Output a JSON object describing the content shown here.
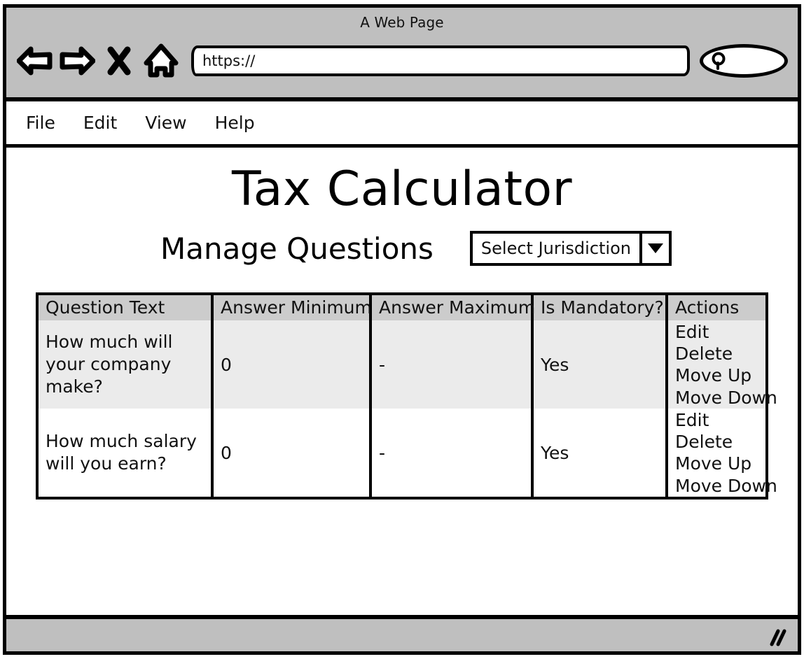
{
  "browser": {
    "window_title": "A Web Page",
    "nav": [
      {
        "name": "back-icon",
        "label": "Back"
      },
      {
        "name": "forward-icon",
        "label": "Forward"
      },
      {
        "name": "stop-icon",
        "label": "Stop"
      },
      {
        "name": "home-icon",
        "label": "Home"
      }
    ],
    "url_value": "https://",
    "url_placeholder": "https://",
    "search_icon": "search-icon",
    "menu": [
      "File",
      "Edit",
      "View",
      "Help"
    ]
  },
  "page": {
    "title": "Tax Calculator",
    "subtitle": "Manage Questions",
    "jurisdiction_dropdown": {
      "selected": "Select Jurisdiction",
      "caret_icon": "chevron-down-icon"
    }
  },
  "table": {
    "headers": [
      "Question Text",
      "Answer Minimum",
      "Answer Maximum",
      "Is Mandatory?",
      "Actions"
    ],
    "rows": [
      {
        "question": "How much will your company make?",
        "answer_minimum": "0",
        "answer_maximum": "-",
        "is_mandatory": "Yes",
        "actions": [
          "Edit",
          "Delete",
          "Move Up",
          "Move Down"
        ]
      },
      {
        "question": "How much salary will you earn?",
        "answer_minimum": "0",
        "answer_maximum": "-",
        "is_mandatory": "Yes",
        "actions": [
          "Edit",
          "Delete",
          "Move Up",
          "Move Down"
        ]
      }
    ]
  },
  "statusbar": {
    "resize_grip_icon": "resize-grip-icon"
  },
  "colors": {
    "chrome_gray": "#bfbfbf",
    "header_gray": "#cccccc",
    "row_alt_gray": "#ebebeb",
    "line_black": "#000000",
    "page_white": "#ffffff"
  }
}
